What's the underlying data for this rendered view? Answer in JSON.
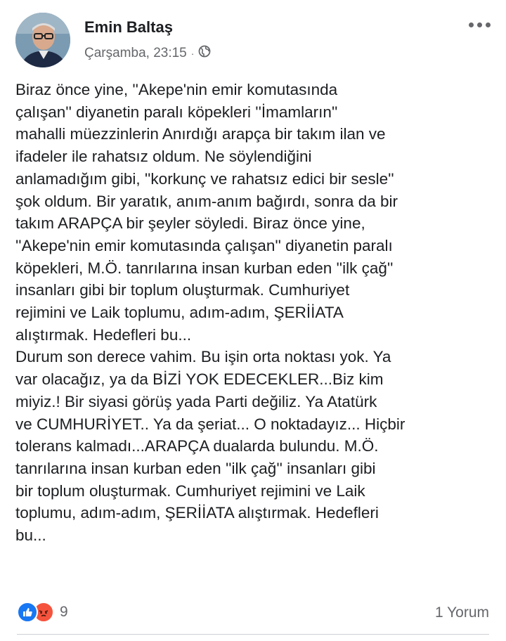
{
  "post": {
    "author": "Emin Baltaş",
    "timestamp": "Çarşamba, 23:15",
    "separator": "·",
    "privacy_icon": "globe-icon",
    "body_lines": [
      "Biraz önce yine,  ''Akepe'nin emir komutasında",
      "çalışan''  diyanetin paralı köpekleri ''İmamların''",
      "mahalli müezzinlerin Anırdığı arapça bir takım ilan ve",
      "ifadeler ile rahatsız oldum.  Ne söylendiğini",
      "anlamadığım gibi, ''korkunç ve rahatsız edici bir sesle''",
      "şok oldum. Bir yaratık, anım-anım bağırdı, sonra da bir",
      "takım ARAPÇA bir şeyler söyledi.  Biraz önce yine,",
      "''Akepe'nin emir komutasında çalışan''  diyanetin paralı",
      "köpekleri, M.Ö. tanrılarına insan kurban eden ''ilk çağ''",
      "insanları gibi bir toplum oluşturmak. Cumhuriyet",
      "rejimini ve Laik toplumu, adım-adım, ŞERİİATA",
      "alıştırmak.  Hedefleri bu...",
      "Durum son derece vahim. Bu işin orta noktası yok.  Ya",
      "var olacağız, ya da BİZİ YOK EDECEKLER...Biz kim",
      "miyiz.!  Bir siyasi görüş yada Parti değiliz. Ya Atatürk",
      "ve CUMHURİYET.. Ya da şeriat... O noktadayız... Hiçbir",
      "tolerans kalmadı...ARAPÇA  dualarda bulundu. M.Ö.",
      "tanrılarına insan kurban eden ''ilk çağ''  insanları gibi",
      "bir toplum oluşturmak. Cumhuriyet rejimini ve Laik",
      "toplumu, adım-adım, ŞERİİATA  alıştırmak.  Hedefleri",
      "bu..."
    ]
  },
  "footer": {
    "reaction_icons": [
      "like-icon",
      "angry-icon"
    ],
    "reaction_count": "9",
    "comment_count": "1 Yorum"
  },
  "colors": {
    "text": "#1c1e21",
    "secondary": "#65676b",
    "like_blue": "#1877f2",
    "angry_orange": "#f5533d",
    "divider": "#ced0d4"
  }
}
